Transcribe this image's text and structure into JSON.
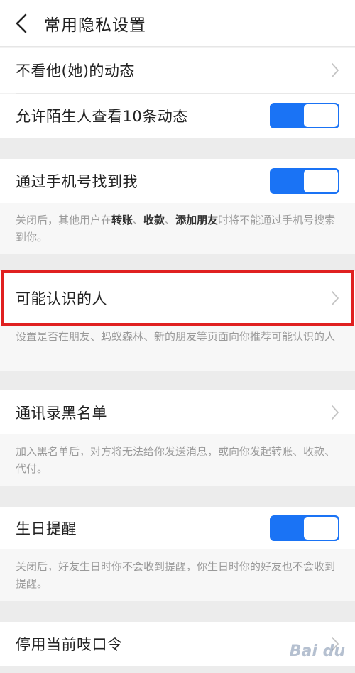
{
  "header": {
    "title": "常用隐私设置",
    "back_icon": "chevron-left-icon"
  },
  "rows": {
    "hide_moments": {
      "label": "不看他(她)的动态"
    },
    "stranger_view": {
      "label": "允许陌生人查看10条动态",
      "toggle_on": true
    },
    "find_by_phone": {
      "label": "通过手机号找到我",
      "toggle_on": true
    },
    "people_may_know": {
      "label": "可能认识的人"
    },
    "blacklist": {
      "label": "通讯录黑名单"
    },
    "birthday": {
      "label": "生日提醒",
      "toggle_on": true
    },
    "disable_code": {
      "label": "停用当前吱口令"
    }
  },
  "descriptions": {
    "phone": {
      "part1": "关闭后，其他用户在",
      "bold1": "转账",
      "sep1": "、",
      "bold2": "收款",
      "sep2": "、",
      "bold3": "添加朋友",
      "part2": "时将不能通过手机号搜索到你。"
    },
    "people_may_know": "设置是否在朋友、蚂蚁森林、新的朋友等页面向你推荐可能认识的人",
    "blacklist": "加入黑名单后，对方将无法给你发送消息，或向你发起转账、收款、代付。",
    "birthday": "关闭后，好友生日时你不会收到提醒，你生日时你的好友也不会收到提醒。"
  },
  "watermark": "Bai du",
  "colors": {
    "accent": "#1a73f5",
    "highlight": "#e02020"
  }
}
